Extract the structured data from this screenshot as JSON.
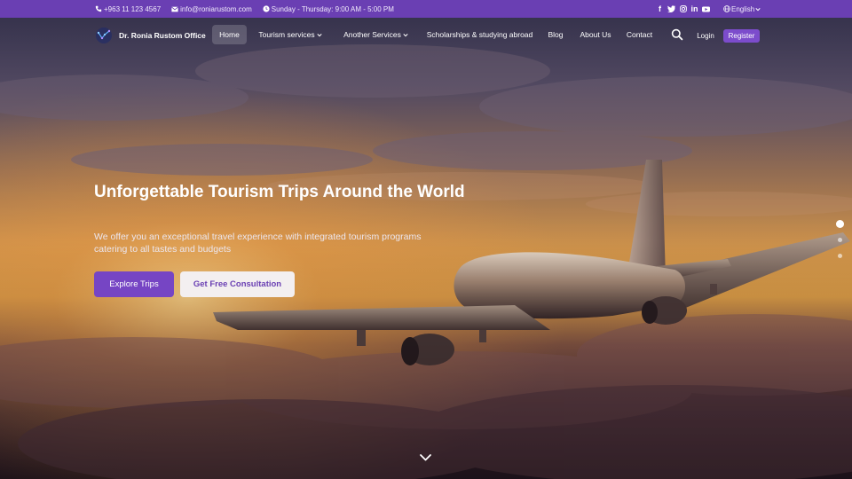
{
  "topbar": {
    "phone": "+963 11 123 4567",
    "email": "info@roniarustom.com",
    "hours": "Sunday - Thursday: 9:00 AM - 5:00 PM",
    "social": [
      {
        "icon": "facebook-icon",
        "glyph": "f"
      },
      {
        "icon": "twitter-icon",
        "glyph": ""
      },
      {
        "icon": "instagram-icon",
        "glyph": ""
      },
      {
        "icon": "linkedin-icon",
        "glyph": "in"
      },
      {
        "icon": "youtube-icon",
        "glyph": ""
      }
    ],
    "language": "English"
  },
  "navbar": {
    "brand": "Dr. Ronia Rustom Office",
    "items": [
      {
        "label": "Home",
        "active": true
      },
      {
        "label": "Tourism services",
        "dropdown": true
      },
      {
        "label": "Another Services",
        "dropdown": true
      },
      {
        "label": "Scholarships & studying abroad"
      },
      {
        "label": "Blog"
      },
      {
        "label": "About Us"
      },
      {
        "label": "Contact"
      }
    ],
    "login": "Login",
    "register": "Register"
  },
  "hero": {
    "title": "Unforgettable Tourism Trips Around the World",
    "subtitle": "We offer you an exceptional travel experience with integrated tourism programs catering to all tastes and budgets",
    "primary_button": "Explore Trips",
    "secondary_button": "Get Free Consultation",
    "slides_total": 3,
    "active_slide": 1
  },
  "colors": {
    "accent": "#6a3fb3",
    "button_primary": "#7645c4",
    "button_secondary_bg": "#f3eff0"
  }
}
